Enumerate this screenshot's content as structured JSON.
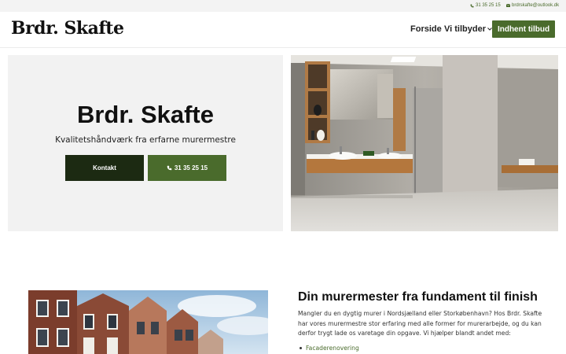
{
  "topbar": {
    "phone": "31 35 25 15",
    "email": "brdrskafte@outlook.dk",
    "phone_icon": "phone-icon",
    "email_icon": "envelope-icon"
  },
  "header": {
    "logo": "Brdr. Skafte",
    "nav": {
      "home": "Forside",
      "services": "Vi tilbyder"
    },
    "cta": "Indhent tilbud"
  },
  "hero": {
    "title": "Brdr. Skafte",
    "subtitle": "Kvalitetshåndværk fra erfarne murermestre",
    "contact_button": "Kontakt",
    "phone_button": "31 35 25 15"
  },
  "intro": {
    "title": "Din murermester fra fundament til finish",
    "body": "Mangler du en dygtig murer i Nordsjælland eller Storkøbenhavn? Hos Brdr. Skafte har vores murermestre stor erfaring med alle former for murerarbejde, og du kan derfor trygt lade os varetage din opgave. Vi hjælper blandt andet med:",
    "list": [
      "Facaderenovering"
    ]
  },
  "colors": {
    "accent": "#4a6b2c",
    "dark_button": "#1c2a12",
    "hero_panel": "#f2f2f2",
    "topbar": "#f3f3f3"
  }
}
